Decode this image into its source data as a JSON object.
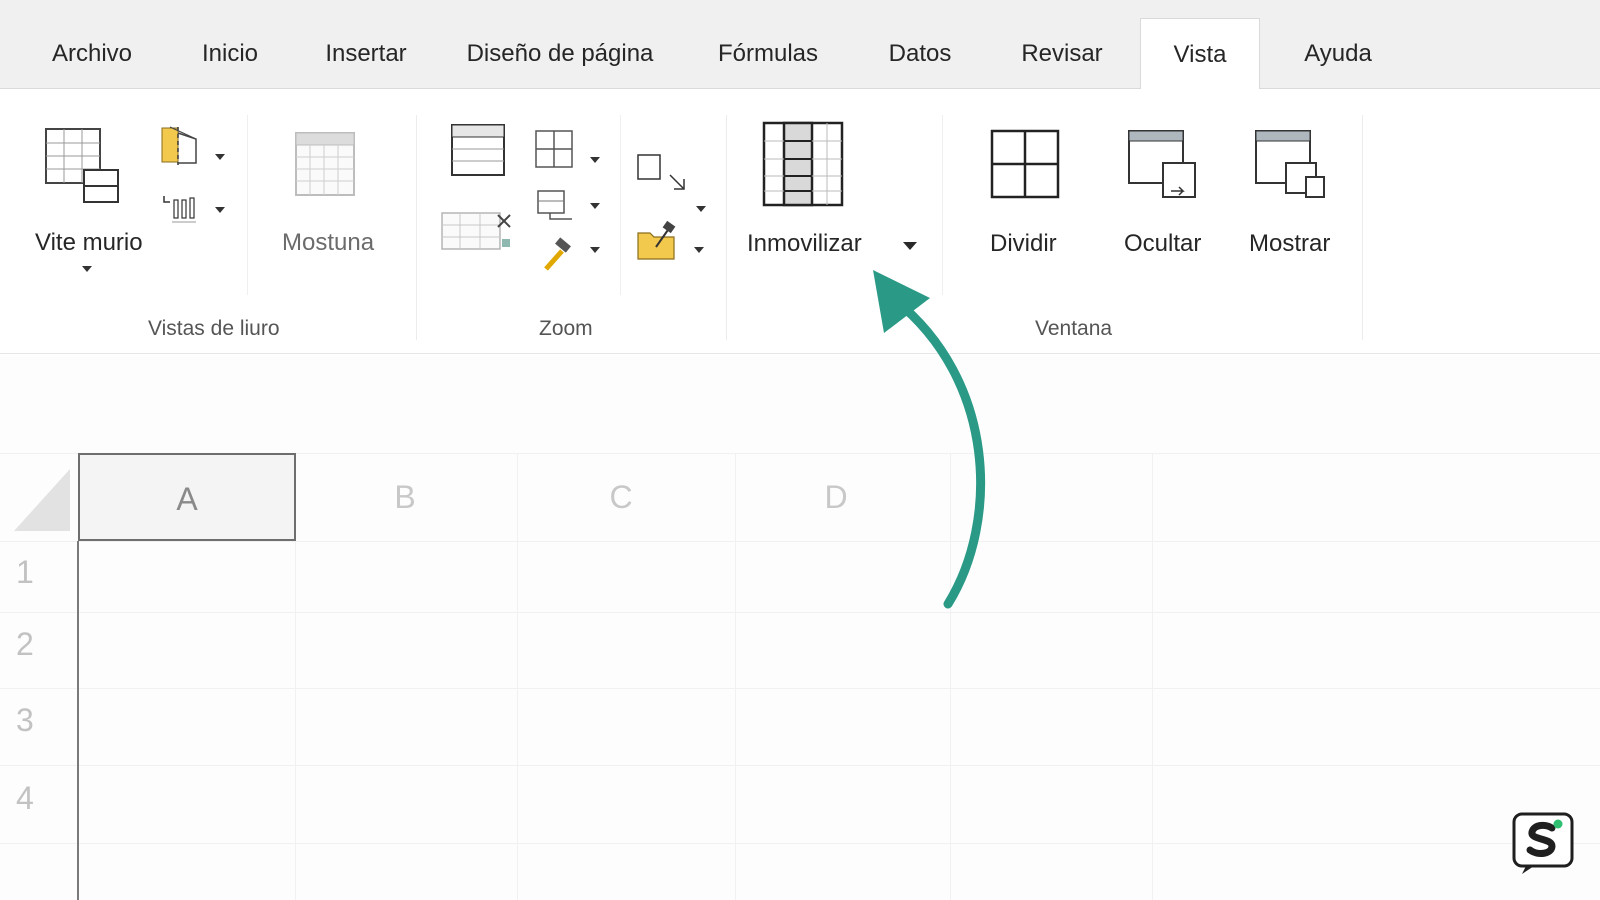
{
  "tabs": [
    {
      "label": "Archivo",
      "active": false
    },
    {
      "label": "Inicio",
      "active": false
    },
    {
      "label": "Insertar",
      "active": false
    },
    {
      "label": "Diseño de página",
      "active": false
    },
    {
      "label": "Fórmulas",
      "active": false
    },
    {
      "label": "Datos",
      "active": false
    },
    {
      "label": "Revisar",
      "active": false
    },
    {
      "label": "Vista",
      "active": true
    },
    {
      "label": "Ayuda",
      "active": false
    }
  ],
  "ribbon": {
    "vistas_libro": {
      "group_label": "Vistas de liuro",
      "normal_label": "Vite murio",
      "mostrar_label": "Mostuna"
    },
    "zoom": {
      "group_label": "Zoom"
    },
    "ventana": {
      "group_label": "Ventana",
      "inmovilizar_label": "Inmovilizar",
      "dividir_label": "Dividir",
      "ocultar_label": "Ocultar",
      "mostrar_label": "Mostrar"
    }
  },
  "sheet": {
    "columns": [
      "A",
      "B",
      "C",
      "D"
    ],
    "rows": [
      "1",
      "2",
      "3",
      "4"
    ],
    "selected_column": "A"
  },
  "colors": {
    "accent_arrow": "#2a9a87",
    "icon_yellow": "#f2c94c",
    "logo_green": "#2fbf71"
  }
}
